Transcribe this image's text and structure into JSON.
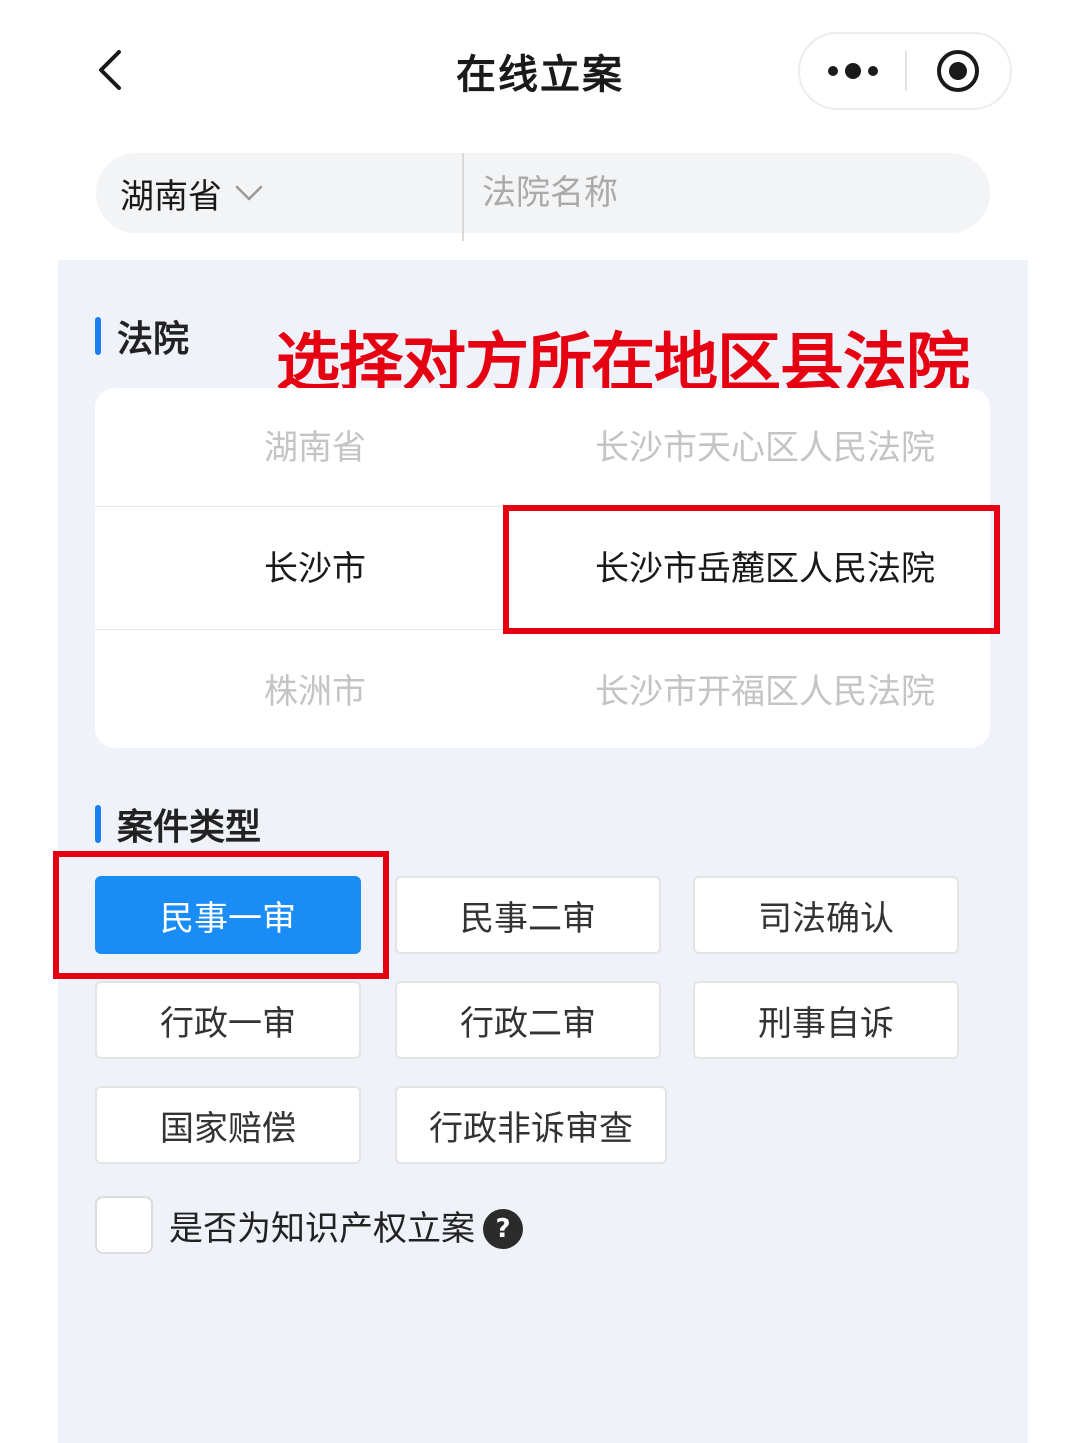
{
  "nav": {
    "title": "在线立案",
    "back_icon": "chevron-left-icon",
    "more_icon": "more-dots-icon",
    "close_icon": "target-circle-icon"
  },
  "search": {
    "province": "湖南省",
    "court_placeholder": "法院名称"
  },
  "court_section": {
    "title": "法院",
    "annotation": "选择对方所在地区县法院",
    "picker_rows": [
      {
        "city": "湖南省",
        "court": "长沙市天心区人民法院",
        "selected": false
      },
      {
        "city": "长沙市",
        "court": "长沙市岳麓区人民法院",
        "selected": true
      },
      {
        "city": "株洲市",
        "court": "长沙市开福区人民法院",
        "selected": false
      }
    ]
  },
  "case_section": {
    "title": "案件类型",
    "types": [
      "民事一审",
      "民事二审",
      "司法确认",
      "行政一审",
      "行政二审",
      "刑事自诉",
      "国家赔偿",
      "行政非诉审查"
    ],
    "selected": "民事一审"
  },
  "ip_option": {
    "label": "是否为知识产权立案",
    "help_symbol": "?",
    "checked": false
  },
  "colors": {
    "accent": "#1a8cf5",
    "annotation_red": "#e50012",
    "panel_bg": "#eff2f8"
  }
}
